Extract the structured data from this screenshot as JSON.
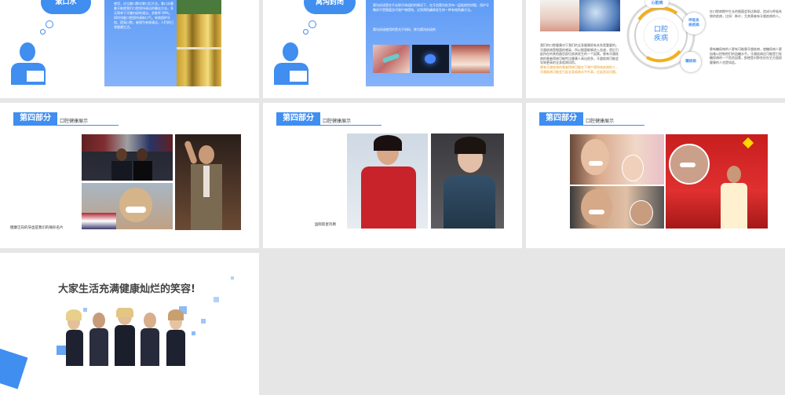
{
  "slide1": {
    "bubble_label": "漱口水",
    "panel_text": "液，以预防和控制口腔疾病为目的的液体。它可以去除口腔中的食物残渣和部分细菌，保持口腔清洁，使口腔清爽。漱口水能有效地清洁口腔，帮助去除口腔中的细菌，预防龋齿和牙周病。",
    "panel_text_2": "使用，应当漱口数次漱口后方法。漱口水最美牙能使我们口腔保持清洁的最佳方法，多天简单于牙缝内部的清洁，多数率 99%，同时也能口腔保持清新口气，有效保护牙齿，提高口腔。被视为有效清洁，人们的日常健康生活。"
  },
  "slide2": {
    "bubble_label": "窝沟封闭",
    "panel_text": "窝沟封闭是在不去除牙体组织的情况下，在牙齿窝沟处涂布一层粘结性树脂，保护牙釉质不受细菌及代谢产物侵蚀，达到预防龋病发生的一种有效防龋方法。",
    "panel_note": "窝沟封闭使用的是光子材料、称为窝沟封闭剂"
  },
  "slide3": {
    "ring_center": "口腔\n疾病",
    "ring_top": "心脏病",
    "ring_right": "呼吸系\n统疾病",
    "ring_bottom": "糖尿病",
    "left_text": "我们的口腔健康对于我们的全身健康很有关系是重要的。牙龈疾病是细菌的感染，所以细菌能够进入血液，然后引起所在的其他器官部位疾病发生的一个因素。患有牙龈疾病的患者得病可能性比健康人高出很多，牙龈疾病可能会导致更高的全身疾病风险。",
    "left_highlight": "患有牙龈疾病的患者得病可能在下增产规则体疾病的人，牙龈疾病可能会引起全身疾病水平升高，迁延恶化问题。",
    "right_text_1": "在口腔病期中生长的细菌会到达肺部，造成与呼吸系统的疾病，比如：肺炎；尤其患者有牙龈疾病的人。",
    "right_text_2": "患有糖尿病的人更有可能患牙龈疾病，使糖尿病人更加难以控制他们的血糖水平。牙龈疾病还可能是引发糖尿病的一个危险因素，即使是对那些仅在它方面很健康的人也是如此。"
  },
  "slide4": {
    "section_tab": "第四部分",
    "section_title": "口腔健康展示",
    "caption": "健康洁白的牙齿是我们的微形名片"
  },
  "slide5": {
    "section_tab": "第四部分",
    "section_title": "口腔健康展示",
    "caption": "国际影星巩俐"
  },
  "slide6": {
    "section_tab": "第四部分",
    "section_title": "口腔健康展示"
  },
  "slide7": {
    "headline": "大家生活充满健康灿烂的笑容!"
  },
  "colors": {
    "accent": "#3f8ef0",
    "background": "#e6e6e6",
    "highlight": "#e89a1c"
  }
}
